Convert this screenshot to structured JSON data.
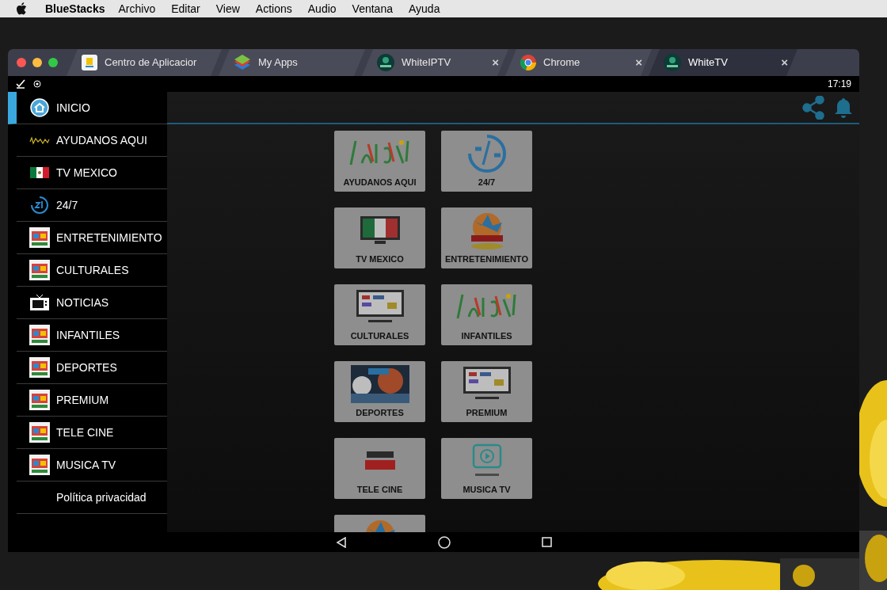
{
  "menu_bar": {
    "app_name": "BlueStacks",
    "items": [
      "Archivo",
      "Editar",
      "View",
      "Actions",
      "Audio",
      "Ventana",
      "Ayuda"
    ]
  },
  "tabs": [
    {
      "label": "Centro de Aplicacior",
      "selected": false
    },
    {
      "label": "My Apps",
      "selected": false
    },
    {
      "label": "WhiteIPTV",
      "selected": false,
      "close": "×"
    },
    {
      "label": "Chrome",
      "selected": false,
      "close": "×"
    },
    {
      "label": "WhiteTV",
      "selected": true,
      "close": "×"
    }
  ],
  "status_bar": {
    "time": "17:19"
  },
  "sidebar": {
    "items": [
      {
        "label": "INICIO",
        "selected": true
      },
      {
        "label": "AYUDANOS AQUI",
        "selected": false
      },
      {
        "label": "TV MEXICO",
        "selected": false
      },
      {
        "label": "24/7",
        "selected": false
      },
      {
        "label": "ENTRETENIMIENTO",
        "selected": false
      },
      {
        "label": "CULTURALES",
        "selected": false
      },
      {
        "label": "NOTICIAS",
        "selected": false
      },
      {
        "label": "INFANTILES",
        "selected": false
      },
      {
        "label": "DEPORTES",
        "selected": false
      },
      {
        "label": "PREMIUM",
        "selected": false
      },
      {
        "label": "TELE CINE",
        "selected": false
      },
      {
        "label": "MUSICA TV",
        "selected": false
      },
      {
        "label": "Política privacidad",
        "selected": false
      }
    ]
  },
  "tiles": [
    {
      "label": "AYUDANOS AQUI"
    },
    {
      "label": "24/7"
    },
    {
      "label": "TV MEXICO"
    },
    {
      "label": "ENTRETENIMIENTO"
    },
    {
      "label": "CULTURALES"
    },
    {
      "label": "INFANTILES"
    },
    {
      "label": "DEPORTES"
    },
    {
      "label": "PREMIUM"
    },
    {
      "label": "TELE CINE"
    },
    {
      "label": "MUSICA TV"
    },
    {
      "kind": "picture"
    }
  ]
}
